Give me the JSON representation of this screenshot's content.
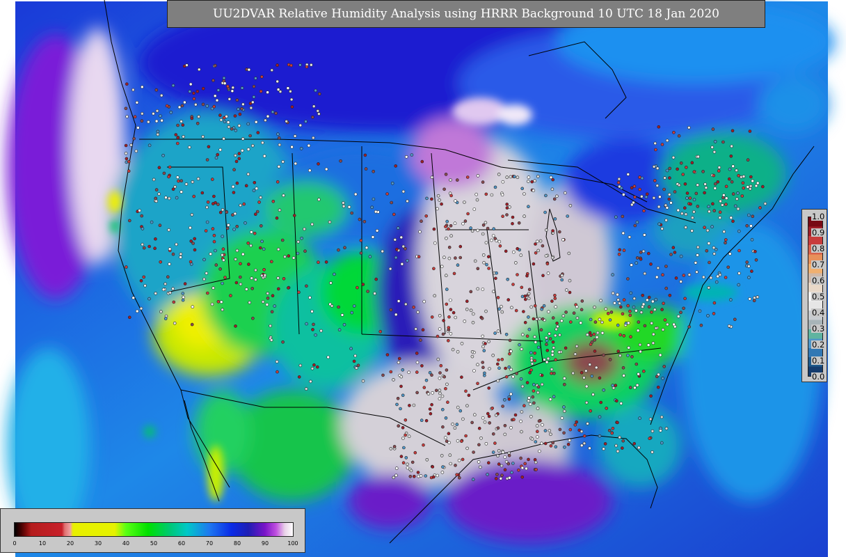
{
  "title": "UU2DVAR Relative Humidity Analysis using HRRR Background 10 UTC 18 Jan 2020",
  "rh_colorbar": {
    "ticks": [
      "0",
      "10",
      "20",
      "30",
      "40",
      "50",
      "60",
      "70",
      "80",
      "90",
      "100"
    ],
    "stops": [
      {
        "v": 0,
        "c": "#000000"
      },
      {
        "v": 2,
        "c": "#3a0000"
      },
      {
        "v": 4,
        "c": "#7a0a0a"
      },
      {
        "v": 6,
        "c": "#b41c1c"
      },
      {
        "v": 17,
        "c": "#c8202a"
      },
      {
        "v": 18,
        "c": "#e07070"
      },
      {
        "v": 20,
        "c": "#f0a0a0"
      },
      {
        "v": 21,
        "c": "#e8f000"
      },
      {
        "v": 36,
        "c": "#e6f200"
      },
      {
        "v": 40,
        "c": "#5aff14"
      },
      {
        "v": 48,
        "c": "#00e000"
      },
      {
        "v": 56,
        "c": "#00c878"
      },
      {
        "v": 62,
        "c": "#00c8c8"
      },
      {
        "v": 70,
        "c": "#1e78f0"
      },
      {
        "v": 78,
        "c": "#0a2ae6"
      },
      {
        "v": 84,
        "c": "#1e1eb4"
      },
      {
        "v": 90,
        "c": "#7a14c8"
      },
      {
        "v": 94,
        "c": "#c050e0"
      },
      {
        "v": 97,
        "c": "#e8d0e8"
      },
      {
        "v": 100,
        "c": "#ffffff"
      }
    ]
  },
  "obs_colorbar": {
    "ticks": [
      "1.0",
      "0.9",
      "0.8",
      "0.7",
      "0.6",
      "0.5",
      "0.4",
      "0.3",
      "0.2",
      "0.1",
      "0.0"
    ],
    "colors": [
      "#143c6e",
      "#1e5a8c",
      "#3278b4",
      "#5096c8",
      "#5fb4a0",
      "#a8b4b8",
      "#c8ccd0",
      "#e6e6e6",
      "#f5f5f5",
      "#e8d8c8",
      "#d0b8a8",
      "#f0b070",
      "#e8905a",
      "#d8604a",
      "#c83c3c",
      "#a01e28",
      "#780a14"
    ]
  }
}
